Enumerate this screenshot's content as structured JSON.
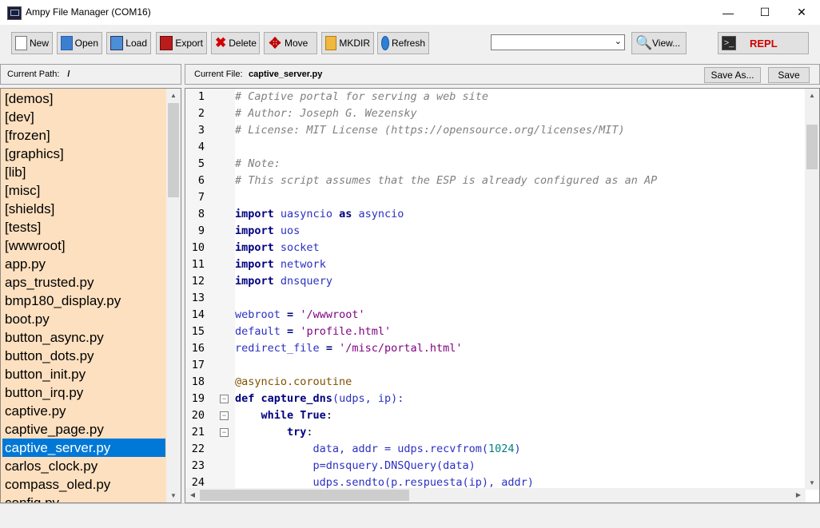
{
  "window": {
    "title": "Ampy File Manager (COM16)",
    "minimize_glyph": "—",
    "maximize_glyph": "☐",
    "close_glyph": "✕"
  },
  "toolbar": {
    "new_label": "New",
    "open_label": "Open",
    "load_label": "Load",
    "export_label": "Export",
    "delete_label": "Delete",
    "move_label": "Move",
    "mkdir_label": "MKDIR",
    "refresh_label": "Refresh",
    "view_label": "View...",
    "repl_label": "REPL",
    "combo_value": ""
  },
  "path": {
    "label": "Current Path:",
    "value": "/"
  },
  "file": {
    "label": "Current File:",
    "value": "captive_server.py",
    "save_as_label": "Save As...",
    "save_label": "Save"
  },
  "files": [
    "[demos]",
    "[dev]",
    "[frozen]",
    "[graphics]",
    "[lib]",
    "[misc]",
    "[shields]",
    "[tests]",
    "[wwwroot]",
    "app.py",
    "aps_trusted.py",
    "bmp180_display.py",
    "boot.py",
    "button_async.py",
    "button_dots.py",
    "button_init.py",
    "button_irq.py",
    "captive.py",
    "captive_page.py",
    "captive_server.py",
    "carlos_clock.py",
    "compass_oled.py",
    "config.py"
  ],
  "selected_file_index": 19,
  "editor": {
    "line_numbers": [
      "1",
      "2",
      "3",
      "4",
      "5",
      "6",
      "7",
      "8",
      "9",
      "10",
      "11",
      "12",
      "13",
      "14",
      "15",
      "16",
      "17",
      "18",
      "19",
      "20",
      "21",
      "22",
      "23",
      "24"
    ],
    "line_1": "# Captive portal for serving a web site",
    "line_2": "# Author: Joseph G. Wezensky",
    "line_3": "# License: MIT License (https://opensource.org/licenses/MIT)",
    "line_5": "# Note:",
    "line_6": "# This script assumes that the ESP is already configured as an AP",
    "kw_import": "import",
    "kw_as": "as",
    "kw_def": "def",
    "kw_while": "while",
    "kw_true": "True",
    "kw_try": "try",
    "mod_uasyncio": "uasyncio",
    "mod_asyncio": "asyncio",
    "mod_uos": "uos",
    "mod_socket": "socket",
    "mod_network": "network",
    "mod_dnsquery": "dnsquery",
    "var_webroot": "webroot",
    "var_default": "default",
    "var_redirect": "redirect_file",
    "op_eq": "=",
    "str_webroot": "'/wwwroot'",
    "str_default": "'profile.html'",
    "str_redirect": "'/misc/portal.html'",
    "decorator": "@asyncio.coroutine",
    "fn_capture": "capture_dns",
    "params_capture": "(udps, ip):",
    "colon": ":",
    "line_22_a": "data, addr = udps.recvfrom(",
    "num_1024": "1024",
    "line_22_b": ")",
    "line_23": "p=dnsquery.DNSQuery(data)",
    "line_24": "udps.sendto(p.respuesta(ip), addr)"
  }
}
